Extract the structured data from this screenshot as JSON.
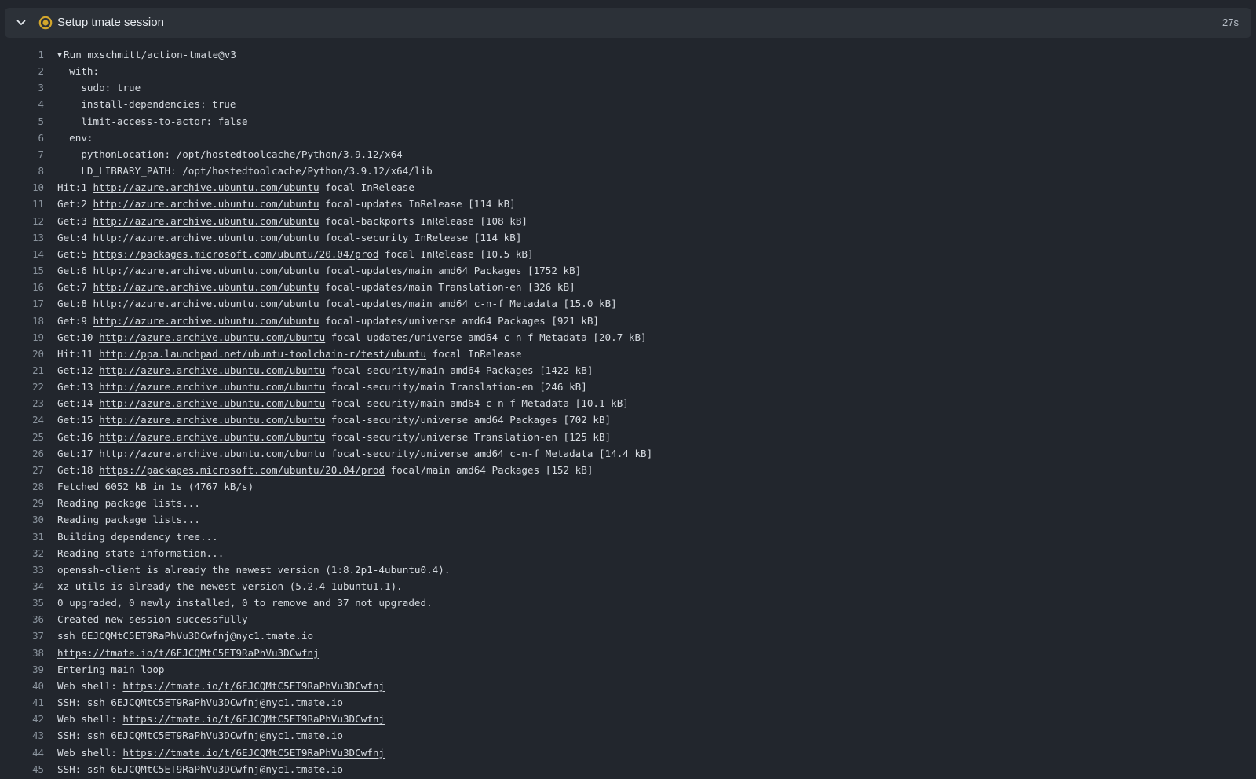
{
  "step": {
    "title": "Setup tmate session",
    "duration": "27s",
    "status_color": "#d4a72c"
  },
  "lines": [
    {
      "n": "1",
      "group": true,
      "parts": [
        {
          "t": "Run mxschmitt/action-tmate@v3"
        }
      ]
    },
    {
      "n": "2",
      "parts": [
        {
          "t": "  with:"
        }
      ]
    },
    {
      "n": "3",
      "parts": [
        {
          "t": "    sudo: true"
        }
      ]
    },
    {
      "n": "4",
      "parts": [
        {
          "t": "    install-dependencies: true"
        }
      ]
    },
    {
      "n": "5",
      "parts": [
        {
          "t": "    limit-access-to-actor: false"
        }
      ]
    },
    {
      "n": "6",
      "parts": [
        {
          "t": "  env:"
        }
      ]
    },
    {
      "n": "7",
      "parts": [
        {
          "t": "    pythonLocation: /opt/hostedtoolcache/Python/3.9.12/x64"
        }
      ]
    },
    {
      "n": "8",
      "parts": [
        {
          "t": "    LD_LIBRARY_PATH: /opt/hostedtoolcache/Python/3.9.12/x64/lib"
        }
      ]
    },
    {
      "n": "10",
      "parts": [
        {
          "t": "Hit:1 "
        },
        {
          "t": "http://azure.archive.ubuntu.com/ubuntu",
          "link": true
        },
        {
          "t": " focal InRelease"
        }
      ]
    },
    {
      "n": "11",
      "parts": [
        {
          "t": "Get:2 "
        },
        {
          "t": "http://azure.archive.ubuntu.com/ubuntu",
          "link": true
        },
        {
          "t": " focal-updates InRelease [114 kB]"
        }
      ]
    },
    {
      "n": "12",
      "parts": [
        {
          "t": "Get:3 "
        },
        {
          "t": "http://azure.archive.ubuntu.com/ubuntu",
          "link": true
        },
        {
          "t": " focal-backports InRelease [108 kB]"
        }
      ]
    },
    {
      "n": "13",
      "parts": [
        {
          "t": "Get:4 "
        },
        {
          "t": "http://azure.archive.ubuntu.com/ubuntu",
          "link": true
        },
        {
          "t": " focal-security InRelease [114 kB]"
        }
      ]
    },
    {
      "n": "14",
      "parts": [
        {
          "t": "Get:5 "
        },
        {
          "t": "https://packages.microsoft.com/ubuntu/20.04/prod",
          "link": true
        },
        {
          "t": " focal InRelease [10.5 kB]"
        }
      ]
    },
    {
      "n": "15",
      "parts": [
        {
          "t": "Get:6 "
        },
        {
          "t": "http://azure.archive.ubuntu.com/ubuntu",
          "link": true
        },
        {
          "t": " focal-updates/main amd64 Packages [1752 kB]"
        }
      ]
    },
    {
      "n": "16",
      "parts": [
        {
          "t": "Get:7 "
        },
        {
          "t": "http://azure.archive.ubuntu.com/ubuntu",
          "link": true
        },
        {
          "t": " focal-updates/main Translation-en [326 kB]"
        }
      ]
    },
    {
      "n": "17",
      "parts": [
        {
          "t": "Get:8 "
        },
        {
          "t": "http://azure.archive.ubuntu.com/ubuntu",
          "link": true
        },
        {
          "t": " focal-updates/main amd64 c-n-f Metadata [15.0 kB]"
        }
      ]
    },
    {
      "n": "18",
      "parts": [
        {
          "t": "Get:9 "
        },
        {
          "t": "http://azure.archive.ubuntu.com/ubuntu",
          "link": true
        },
        {
          "t": " focal-updates/universe amd64 Packages [921 kB]"
        }
      ]
    },
    {
      "n": "19",
      "parts": [
        {
          "t": "Get:10 "
        },
        {
          "t": "http://azure.archive.ubuntu.com/ubuntu",
          "link": true
        },
        {
          "t": " focal-updates/universe amd64 c-n-f Metadata [20.7 kB]"
        }
      ]
    },
    {
      "n": "20",
      "parts": [
        {
          "t": "Hit:11 "
        },
        {
          "t": "http://ppa.launchpad.net/ubuntu-toolchain-r/test/ubuntu",
          "link": true
        },
        {
          "t": " focal InRelease"
        }
      ]
    },
    {
      "n": "21",
      "parts": [
        {
          "t": "Get:12 "
        },
        {
          "t": "http://azure.archive.ubuntu.com/ubuntu",
          "link": true
        },
        {
          "t": " focal-security/main amd64 Packages [1422 kB]"
        }
      ]
    },
    {
      "n": "22",
      "parts": [
        {
          "t": "Get:13 "
        },
        {
          "t": "http://azure.archive.ubuntu.com/ubuntu",
          "link": true
        },
        {
          "t": " focal-security/main Translation-en [246 kB]"
        }
      ]
    },
    {
      "n": "23",
      "parts": [
        {
          "t": "Get:14 "
        },
        {
          "t": "http://azure.archive.ubuntu.com/ubuntu",
          "link": true
        },
        {
          "t": " focal-security/main amd64 c-n-f Metadata [10.1 kB]"
        }
      ]
    },
    {
      "n": "24",
      "parts": [
        {
          "t": "Get:15 "
        },
        {
          "t": "http://azure.archive.ubuntu.com/ubuntu",
          "link": true
        },
        {
          "t": " focal-security/universe amd64 Packages [702 kB]"
        }
      ]
    },
    {
      "n": "25",
      "parts": [
        {
          "t": "Get:16 "
        },
        {
          "t": "http://azure.archive.ubuntu.com/ubuntu",
          "link": true
        },
        {
          "t": " focal-security/universe Translation-en [125 kB]"
        }
      ]
    },
    {
      "n": "26",
      "parts": [
        {
          "t": "Get:17 "
        },
        {
          "t": "http://azure.archive.ubuntu.com/ubuntu",
          "link": true
        },
        {
          "t": " focal-security/universe amd64 c-n-f Metadata [14.4 kB]"
        }
      ]
    },
    {
      "n": "27",
      "parts": [
        {
          "t": "Get:18 "
        },
        {
          "t": "https://packages.microsoft.com/ubuntu/20.04/prod",
          "link": true
        },
        {
          "t": " focal/main amd64 Packages [152 kB]"
        }
      ]
    },
    {
      "n": "28",
      "parts": [
        {
          "t": "Fetched 6052 kB in 1s (4767 kB/s)"
        }
      ]
    },
    {
      "n": "29",
      "parts": [
        {
          "t": "Reading package lists..."
        }
      ]
    },
    {
      "n": "30",
      "parts": [
        {
          "t": "Reading package lists..."
        }
      ]
    },
    {
      "n": "31",
      "parts": [
        {
          "t": "Building dependency tree..."
        }
      ]
    },
    {
      "n": "32",
      "parts": [
        {
          "t": "Reading state information..."
        }
      ]
    },
    {
      "n": "33",
      "parts": [
        {
          "t": "openssh-client is already the newest version (1:8.2p1-4ubuntu0.4)."
        }
      ]
    },
    {
      "n": "34",
      "parts": [
        {
          "t": "xz-utils is already the newest version (5.2.4-1ubuntu1.1)."
        }
      ]
    },
    {
      "n": "35",
      "parts": [
        {
          "t": "0 upgraded, 0 newly installed, 0 to remove and 37 not upgraded."
        }
      ]
    },
    {
      "n": "36",
      "parts": [
        {
          "t": "Created new session successfully"
        }
      ]
    },
    {
      "n": "37",
      "parts": [
        {
          "t": "ssh 6EJCQMtC5ET9RaPhVu3DCwfnj@nyc1.tmate.io"
        }
      ]
    },
    {
      "n": "38",
      "parts": [
        {
          "t": "https://tmate.io/t/6EJCQMtC5ET9RaPhVu3DCwfnj",
          "link": true
        }
      ]
    },
    {
      "n": "39",
      "parts": [
        {
          "t": "Entering main loop"
        }
      ]
    },
    {
      "n": "40",
      "parts": [
        {
          "t": "Web shell: "
        },
        {
          "t": "https://tmate.io/t/6EJCQMtC5ET9RaPhVu3DCwfnj",
          "link": true
        }
      ]
    },
    {
      "n": "41",
      "parts": [
        {
          "t": "SSH: ssh 6EJCQMtC5ET9RaPhVu3DCwfnj@nyc1.tmate.io"
        }
      ]
    },
    {
      "n": "42",
      "parts": [
        {
          "t": "Web shell: "
        },
        {
          "t": "https://tmate.io/t/6EJCQMtC5ET9RaPhVu3DCwfnj",
          "link": true
        }
      ]
    },
    {
      "n": "43",
      "parts": [
        {
          "t": "SSH: ssh 6EJCQMtC5ET9RaPhVu3DCwfnj@nyc1.tmate.io"
        }
      ]
    },
    {
      "n": "44",
      "parts": [
        {
          "t": "Web shell: "
        },
        {
          "t": "https://tmate.io/t/6EJCQMtC5ET9RaPhVu3DCwfnj",
          "link": true
        }
      ]
    },
    {
      "n": "45",
      "parts": [
        {
          "t": "SSH: ssh 6EJCQMtC5ET9RaPhVu3DCwfnj@nyc1.tmate.io"
        }
      ]
    }
  ]
}
